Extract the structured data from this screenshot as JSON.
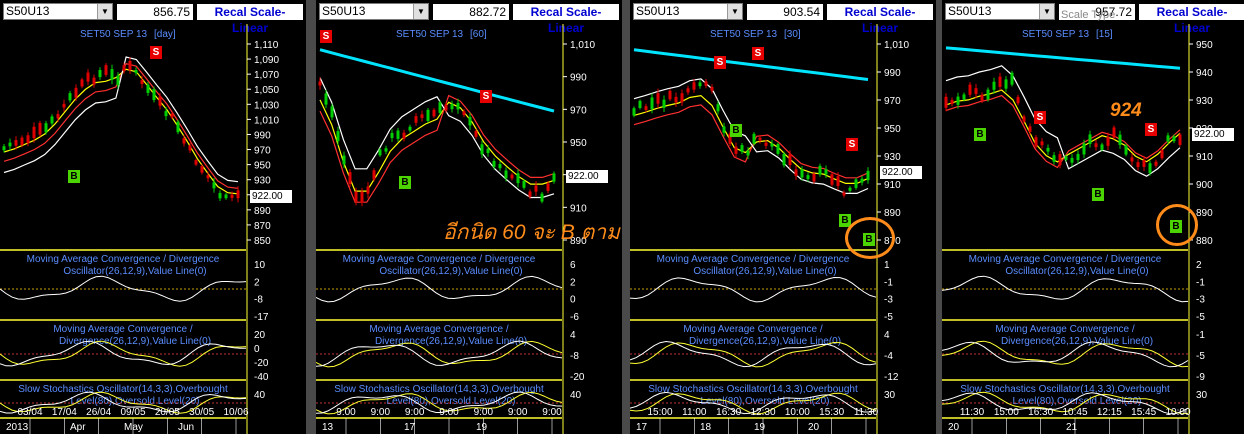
{
  "panels": [
    {
      "symbol": "S50U13",
      "price": "856.75",
      "recal": "Recal Scale-Linear",
      "title": "SET50 SEP 13",
      "interval": "[day]",
      "price_ticks": [
        "1,110",
        "1,090",
        "1,070",
        "1,050",
        "1,030",
        "1,010",
        "990",
        "970",
        "950",
        "930",
        "910",
        "890",
        "870",
        "850"
      ],
      "last_price": "922.00",
      "macd1_label1": "Moving Average Convergence / Divergence",
      "macd1_label2": "Oscillator(26,12,9),Value Line(0)",
      "macd1_ticks": [
        "10",
        "2",
        "-8",
        "-17"
      ],
      "macd2_label1": "Moving Average Convergence /",
      "macd2_label2": "Divergence(26,12,9),Value Line(0)",
      "macd2_ticks": [
        "20",
        "0",
        "-20",
        "-40"
      ],
      "stoch_label1": "Slow Stochastics Oscillator(14,3,3),Overbought",
      "stoch_label2": "Level(80),Oversold Level(20)",
      "stoch_ticks": [
        "40"
      ],
      "time_labels": [
        "03/04",
        "17/04",
        "26/04",
        "09/05",
        "20/05",
        "30/05",
        "10/06"
      ],
      "date_labels": [
        "2013",
        "Apr",
        "May",
        "Jun"
      ]
    },
    {
      "symbol": "S50U13",
      "price": "882.72",
      "recal": "Recal Scale-Linear",
      "title": "SET50 SEP 13",
      "interval": "[60]",
      "price_ticks": [
        "1,010",
        "990",
        "970",
        "950",
        "930",
        "910",
        "890"
      ],
      "last_price": "922.00",
      "macd1_label1": "Moving Average Convergence / Divergence",
      "macd1_label2": "Oscillator(26,12,9),Value Line(0)",
      "macd1_ticks": [
        "6",
        "2",
        "0",
        "-6"
      ],
      "macd2_label1": "Moving Average Convergence /",
      "macd2_label2": "Divergence(26,12,9),Value Line(0)",
      "macd2_ticks": [
        "4",
        "-8",
        "-20"
      ],
      "stoch_label1": "Slow Stochastics Oscillator(14,3,3),Overbought",
      "stoch_label2": "Level(80),Oversold Level(20)",
      "stoch_ticks": [
        "40"
      ],
      "time_labels": [
        "9:00",
        "9:00",
        "9:00",
        "9:00",
        "9:00",
        "9:00",
        "9:00"
      ],
      "date_labels": [
        "13",
        "17",
        "19"
      ]
    },
    {
      "symbol": "S50U13",
      "price": "903.54",
      "recal": "Recal Scale-Linear",
      "title": "SET50 SEP 13",
      "interval": "[30]",
      "price_ticks": [
        "1,010",
        "990",
        "970",
        "950",
        "930",
        "910",
        "890",
        "870"
      ],
      "last_price": "922.00",
      "macd1_label1": "Moving Average Convergence / Divergence",
      "macd1_label2": "Oscillator(26,12,9),Value Line(0)",
      "macd1_ticks": [
        "1",
        "-1",
        "-3",
        "-5"
      ],
      "macd2_label1": "Moving Average Convergence /",
      "macd2_label2": "Divergence(26,12,9),Value Line(0)",
      "macd2_ticks": [
        "4",
        "-4",
        "-12"
      ],
      "stoch_label1": "Slow Stochastics Oscillator(14,3,3),Overbought",
      "stoch_label2": "Level(80),Oversold Level(20)",
      "stoch_ticks": [
        "30"
      ],
      "time_labels": [
        "15:00",
        "11:00",
        "16:30",
        "12:30",
        "10:00",
        "15:30",
        "11:30"
      ],
      "date_labels": [
        "17",
        "18",
        "19",
        "20"
      ]
    },
    {
      "symbol": "S50U13",
      "price": "957.72",
      "recal": "Recal Scale-Linear",
      "title": "SET50 SEP 13",
      "interval": "[15]",
      "price_ticks": [
        "950",
        "940",
        "930",
        "920",
        "910",
        "900",
        "890",
        "880"
      ],
      "last_price": "922.00",
      "macd1_label1": "Moving Average Convergence / Divergence",
      "macd1_label2": "Oscillator(26,12,9),Value Line(0)",
      "macd1_ticks": [
        "2",
        "-1",
        "-3",
        "-5"
      ],
      "macd2_label1": "Moving Average Convergence /",
      "macd2_label2": "Divergence(26,12,9),Value Line(0)",
      "macd2_ticks": [
        "-1",
        "-5",
        "-9"
      ],
      "stoch_label1": "Slow Stochastics Oscillator(14,3,3),Overbought",
      "stoch_label2": "Level(80),Oversold Level(20)",
      "stoch_ticks": [
        "30"
      ],
      "time_labels": [
        "11:30",
        "15:00",
        "16:30",
        "10:45",
        "12:15",
        "15:45",
        "10:00"
      ],
      "date_labels": [
        "20",
        "21"
      ]
    }
  ],
  "tags": {
    "sell": "S",
    "buy": "B"
  },
  "annotations": {
    "thai_note": "อีกนิด 60 จะ B ตาม",
    "level_924": "924",
    "scale_ghost": "Scale Type"
  },
  "colors": {
    "candle_up": "#00d000",
    "candle_down": "#e00000",
    "ma_yellow": "#ffff00",
    "ma_red": "#ff3030",
    "ma_white": "#ffffff",
    "ma_cyan": "#00e5ff",
    "annotation": "#ff8c1a",
    "title_blue": "#5a8dff"
  }
}
